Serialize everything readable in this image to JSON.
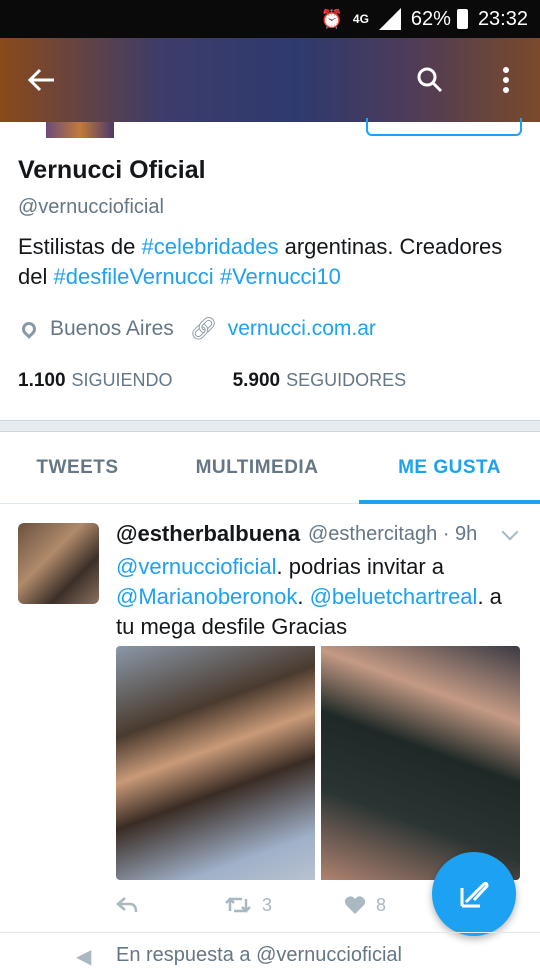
{
  "status_bar": {
    "network": "4G",
    "battery": "62%",
    "time": "23:32"
  },
  "profile": {
    "name": "Vernucci Oficial",
    "handle": "@vernuccioficial",
    "bio": [
      {
        "text": "Estilistas de ",
        "link": false
      },
      {
        "text": "#celebridades",
        "link": true
      },
      {
        "text": " argentinas. Creadores del ",
        "link": false
      },
      {
        "text": "#desfileVernucci",
        "link": true
      },
      {
        "text": " ",
        "link": false
      },
      {
        "text": "#Vernucci10",
        "link": true
      }
    ],
    "location": "Buenos Aires",
    "website": "vernucci.com.ar",
    "following_count": "1.100",
    "following_label": "SIGUIENDO",
    "followers_count": "5.900",
    "followers_label": "SEGUIDORES"
  },
  "tabs": [
    {
      "label": "TWEETS",
      "active": false
    },
    {
      "label": "MULTIMEDIA",
      "active": false
    },
    {
      "label": "ME GUSTA",
      "active": true
    }
  ],
  "tweet": {
    "name": "@estherbalbuena",
    "handle": "@esthercitagh",
    "time": "· 9h",
    "text": [
      {
        "text": "@vernuccioficial",
        "link": true
      },
      {
        "text": ". podrias invitar a ",
        "link": false
      },
      {
        "text": "@Marianoberonok",
        "link": true
      },
      {
        "text": ". ",
        "link": false
      },
      {
        "text": "@beluetchartreal",
        "link": true
      },
      {
        "text": ". a tu mega desfile Gracias",
        "link": false
      }
    ],
    "retweets": "3",
    "likes": "8"
  },
  "next_tweet": {
    "reply_text": "En respuesta a @vernuccioficial"
  },
  "colors": {
    "accent": "#1da1f2",
    "muted": "#657786"
  }
}
